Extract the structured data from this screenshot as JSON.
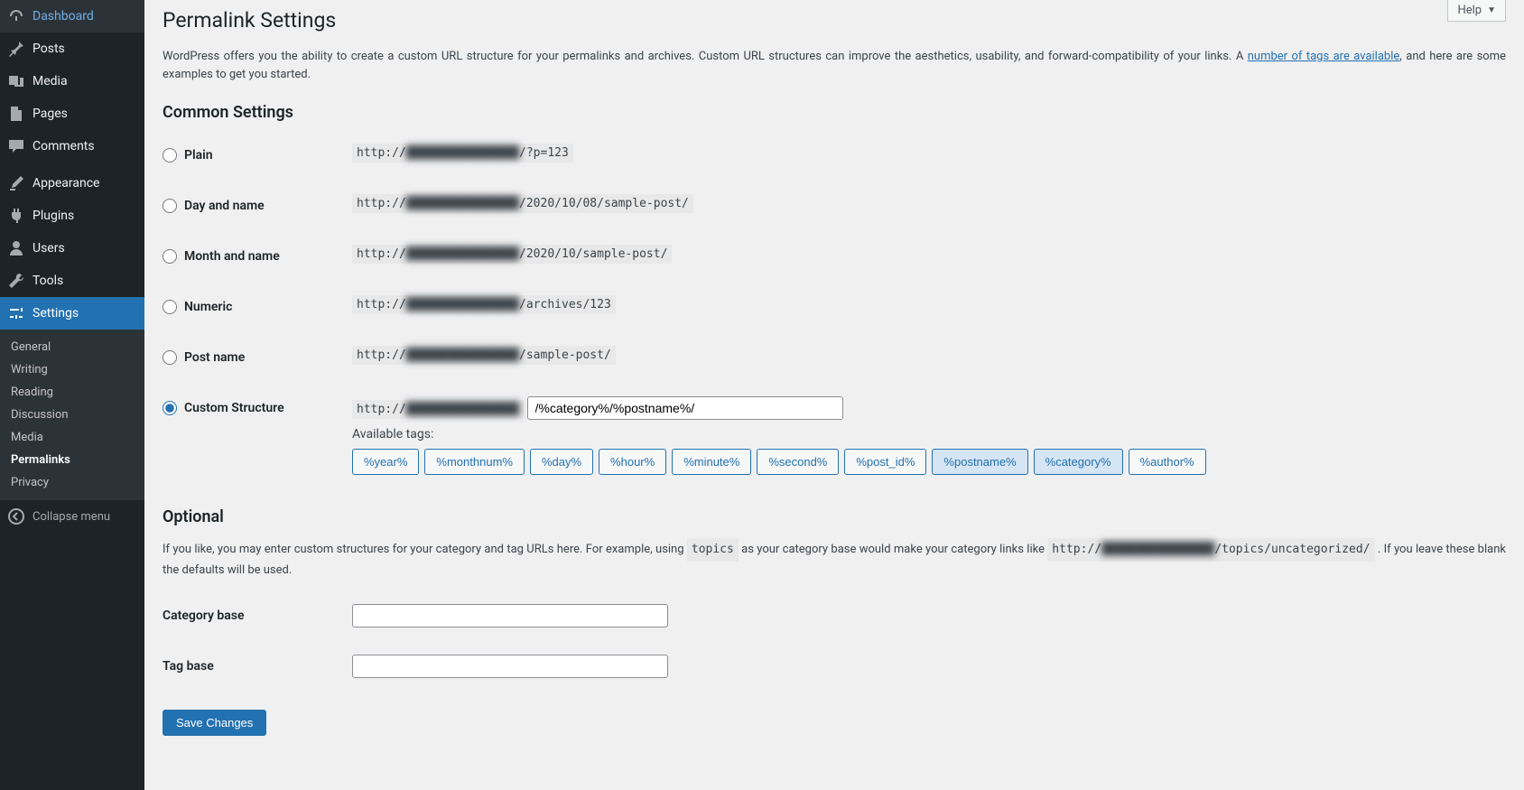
{
  "sidebar": {
    "items": [
      {
        "label": "Dashboard",
        "name": "sidebar-item-dashboard",
        "icon": "dashboard-icon"
      },
      {
        "label": "Posts",
        "name": "sidebar-item-posts",
        "icon": "pin-icon"
      },
      {
        "label": "Media",
        "name": "sidebar-item-media",
        "icon": "media-icon"
      },
      {
        "label": "Pages",
        "name": "sidebar-item-pages",
        "icon": "page-icon"
      },
      {
        "label": "Comments",
        "name": "sidebar-item-comments",
        "icon": "comment-icon"
      },
      {
        "label": "Appearance",
        "name": "sidebar-item-appearance",
        "icon": "brush-icon"
      },
      {
        "label": "Plugins",
        "name": "sidebar-item-plugins",
        "icon": "plug-icon"
      },
      {
        "label": "Users",
        "name": "sidebar-item-users",
        "icon": "user-icon"
      },
      {
        "label": "Tools",
        "name": "sidebar-item-tools",
        "icon": "wrench-icon"
      },
      {
        "label": "Settings",
        "name": "sidebar-item-settings",
        "icon": "sliders-icon",
        "current": true
      }
    ],
    "submenu": [
      {
        "label": "General",
        "name": "submenu-item-general"
      },
      {
        "label": "Writing",
        "name": "submenu-item-writing"
      },
      {
        "label": "Reading",
        "name": "submenu-item-reading"
      },
      {
        "label": "Discussion",
        "name": "submenu-item-discussion"
      },
      {
        "label": "Media",
        "name": "submenu-item-media"
      },
      {
        "label": "Permalinks",
        "name": "submenu-item-permalinks",
        "current": true
      },
      {
        "label": "Privacy",
        "name": "submenu-item-privacy"
      }
    ],
    "collapse_label": "Collapse menu"
  },
  "help_label": "Help",
  "page": {
    "title": "Permalink Settings",
    "intro_before": "WordPress offers you the ability to create a custom URL structure for your permalinks and archives. Custom URL structures can improve the aesthetics, usability, and forward-compatibility of your links. A ",
    "intro_link": "number of tags are available",
    "intro_after": ", and here are some examples to get you started.",
    "common_heading": "Common Settings",
    "url_prefix": "http://",
    "url_domain": "████████████████",
    "options": {
      "plain": {
        "label": "Plain",
        "suffix": "/?p=123"
      },
      "dayname": {
        "label": "Day and name",
        "suffix": "/2020/10/08/sample-post/"
      },
      "monthname": {
        "label": "Month and name",
        "suffix": "/2020/10/sample-post/"
      },
      "numeric": {
        "label": "Numeric",
        "suffix": "/archives/123"
      },
      "postname": {
        "label": "Post name",
        "suffix": "/sample-post/"
      },
      "custom": {
        "label": "Custom Structure",
        "value": "/%category%/%postname%/"
      }
    },
    "available_tags_label": "Available tags:",
    "tags": [
      {
        "label": "%year%",
        "active": false
      },
      {
        "label": "%monthnum%",
        "active": false
      },
      {
        "label": "%day%",
        "active": false
      },
      {
        "label": "%hour%",
        "active": false
      },
      {
        "label": "%minute%",
        "active": false
      },
      {
        "label": "%second%",
        "active": false
      },
      {
        "label": "%post_id%",
        "active": false
      },
      {
        "label": "%postname%",
        "active": true
      },
      {
        "label": "%category%",
        "active": true
      },
      {
        "label": "%author%",
        "active": false
      }
    ],
    "optional_heading": "Optional",
    "optional_desc_before": "If you like, you may enter custom structures for your category and tag URLs here. For example, using ",
    "optional_desc_code": "topics",
    "optional_desc_mid": " as your category base would make your category links like ",
    "optional_desc_url_suffix": "/topics/uncategorized/",
    "optional_desc_after": " . If you leave these blank the defaults will be used.",
    "category_base_label": "Category base",
    "tag_base_label": "Tag base",
    "save_label": "Save Changes"
  }
}
